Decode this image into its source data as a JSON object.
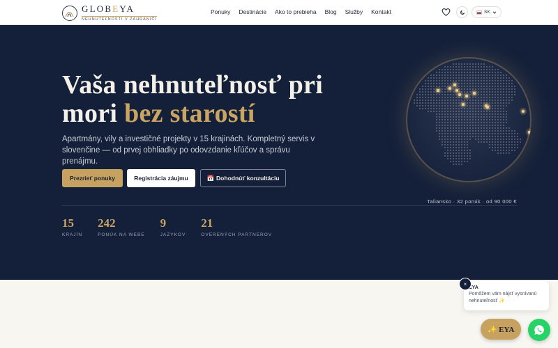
{
  "header": {
    "brand": {
      "name_start": "GLOB",
      "name_accent": "E",
      "name_end": "YA",
      "tagline": "NEHNUTEĽNOSTI V ZAHRANIČÍ"
    },
    "nav": [
      "Ponuky",
      "Destinácie",
      "Ako to prebieha",
      "Blog",
      "Služby",
      "Kontakt"
    ],
    "language": "SK",
    "icons": {
      "favorites": "heart-icon",
      "theme": "moon-icon",
      "flag": "slovak-flag-icon",
      "dropdown": "chevron-down-icon"
    }
  },
  "hero": {
    "title_line1": "Vaša nehnuteľnosť pri",
    "title_line2_plain": "mori ",
    "title_line2_accent": "bez starostí",
    "lead": "Apartmány, vily a investičné projekty v 15 krajinách. Kompletný servis v slovenčine — od prvej obhliadky po odovzdanie kľúčov a správu prenájmu.",
    "buttons": {
      "primary": "Prezrieť ponuky",
      "secondary": "Registrácia záujmu",
      "tertiary_icon": "📅",
      "tertiary": "Dohodnúť konzultáciu"
    },
    "globe_caption": "Taliansko · 32 ponúk · od 90 000 €",
    "stats": [
      {
        "value": "15",
        "label": "KRAJÍN"
      },
      {
        "value": "242",
        "label": "PONÚK NA WEBE"
      },
      {
        "value": "9",
        "label": "JAZYKOV"
      },
      {
        "value": "21",
        "label": "OVERENÝCH PARTNEROV"
      }
    ]
  },
  "chat": {
    "close": "×",
    "name": "EYA",
    "message": "Pomôžem vám nájsť vysnívanú nehnuteľnosť ✨",
    "launcher": "✨ EYA",
    "whatsapp_icon": "whatsapp-icon"
  },
  "colors": {
    "navy": "#14203a",
    "gold": "#c9a463",
    "button_gold": "#c6a160",
    "whatsapp": "#25d366"
  }
}
